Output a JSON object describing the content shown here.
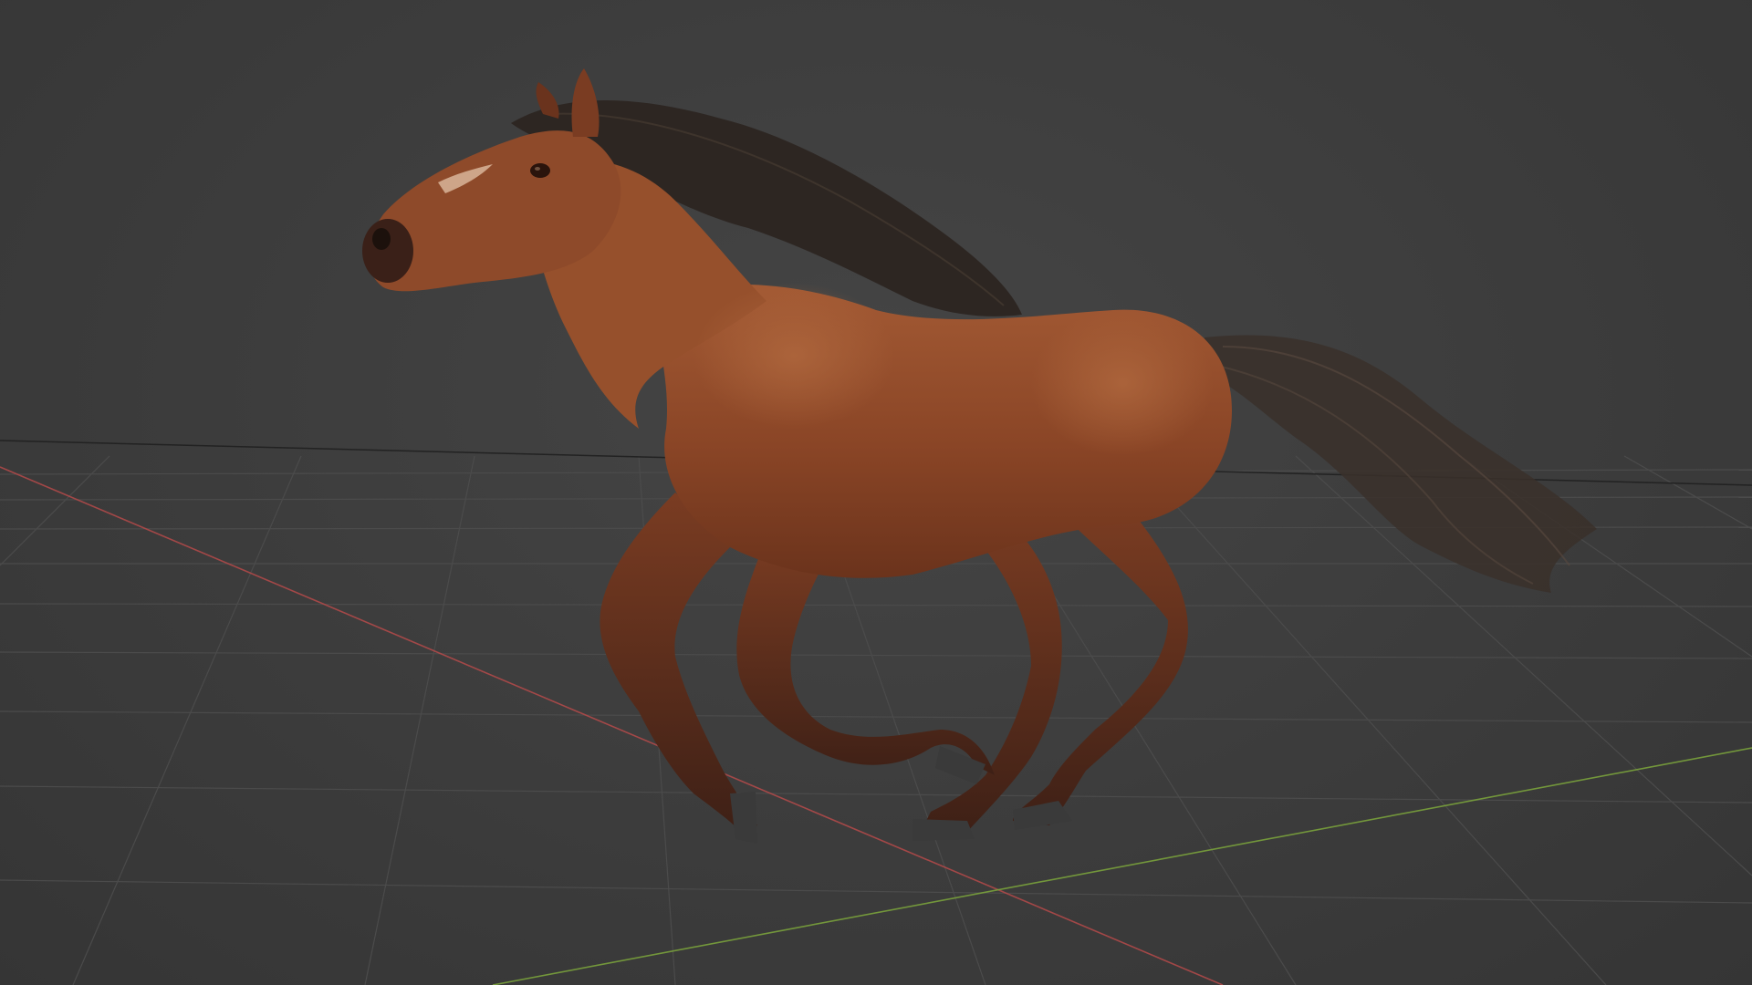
{
  "viewport": {
    "background_color": "#3d3d3d",
    "grid_color": "#4a4a4a",
    "x_axis_color": "#b54a4a",
    "y_axis_color": "#7aa23c"
  },
  "model": {
    "subject": "horse",
    "pose": "gallop",
    "coat_color": "#8a4526",
    "mane_color": "#2b2420",
    "hoof_color": "#3a3a3a"
  }
}
